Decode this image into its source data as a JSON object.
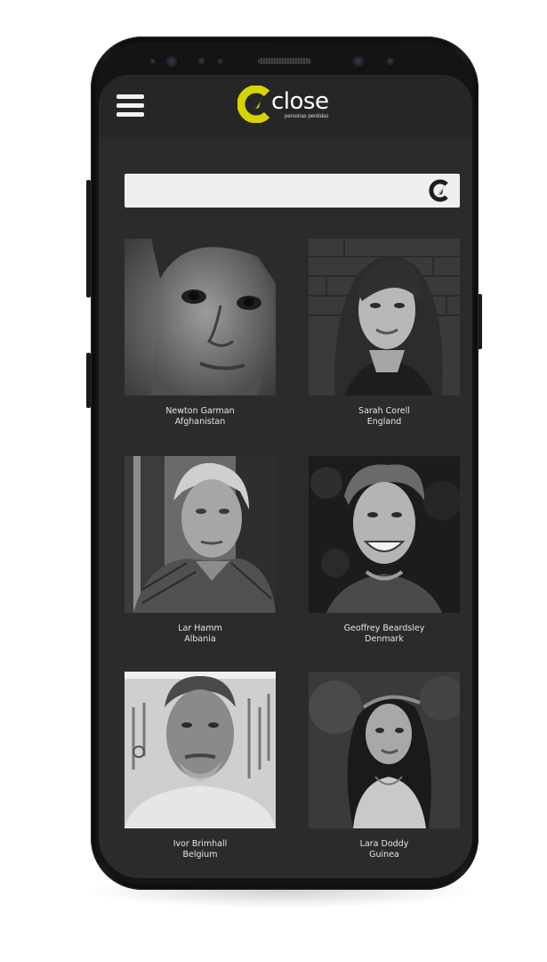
{
  "app": {
    "name": "close",
    "tagline": "personas perdidas",
    "accent_color": "#d4d400"
  },
  "header": {
    "menu_icon": "hamburger-menu-icon",
    "logo_icon": "close-logo-icon"
  },
  "search": {
    "placeholder": "",
    "value": "",
    "icon": "close-logo-search-icon"
  },
  "people": [
    {
      "name": "Newton Garman",
      "country": "Afghanistan"
    },
    {
      "name": "Sarah Corell",
      "country": "England"
    },
    {
      "name": "Lar Hamm",
      "country": "Albania"
    },
    {
      "name": "Geoffrey Beardsley",
      "country": "Denmark"
    },
    {
      "name": "Ivor Brimhall",
      "country": "Belgium"
    },
    {
      "name": "Lara Doddy",
      "country": "Guinea"
    }
  ]
}
